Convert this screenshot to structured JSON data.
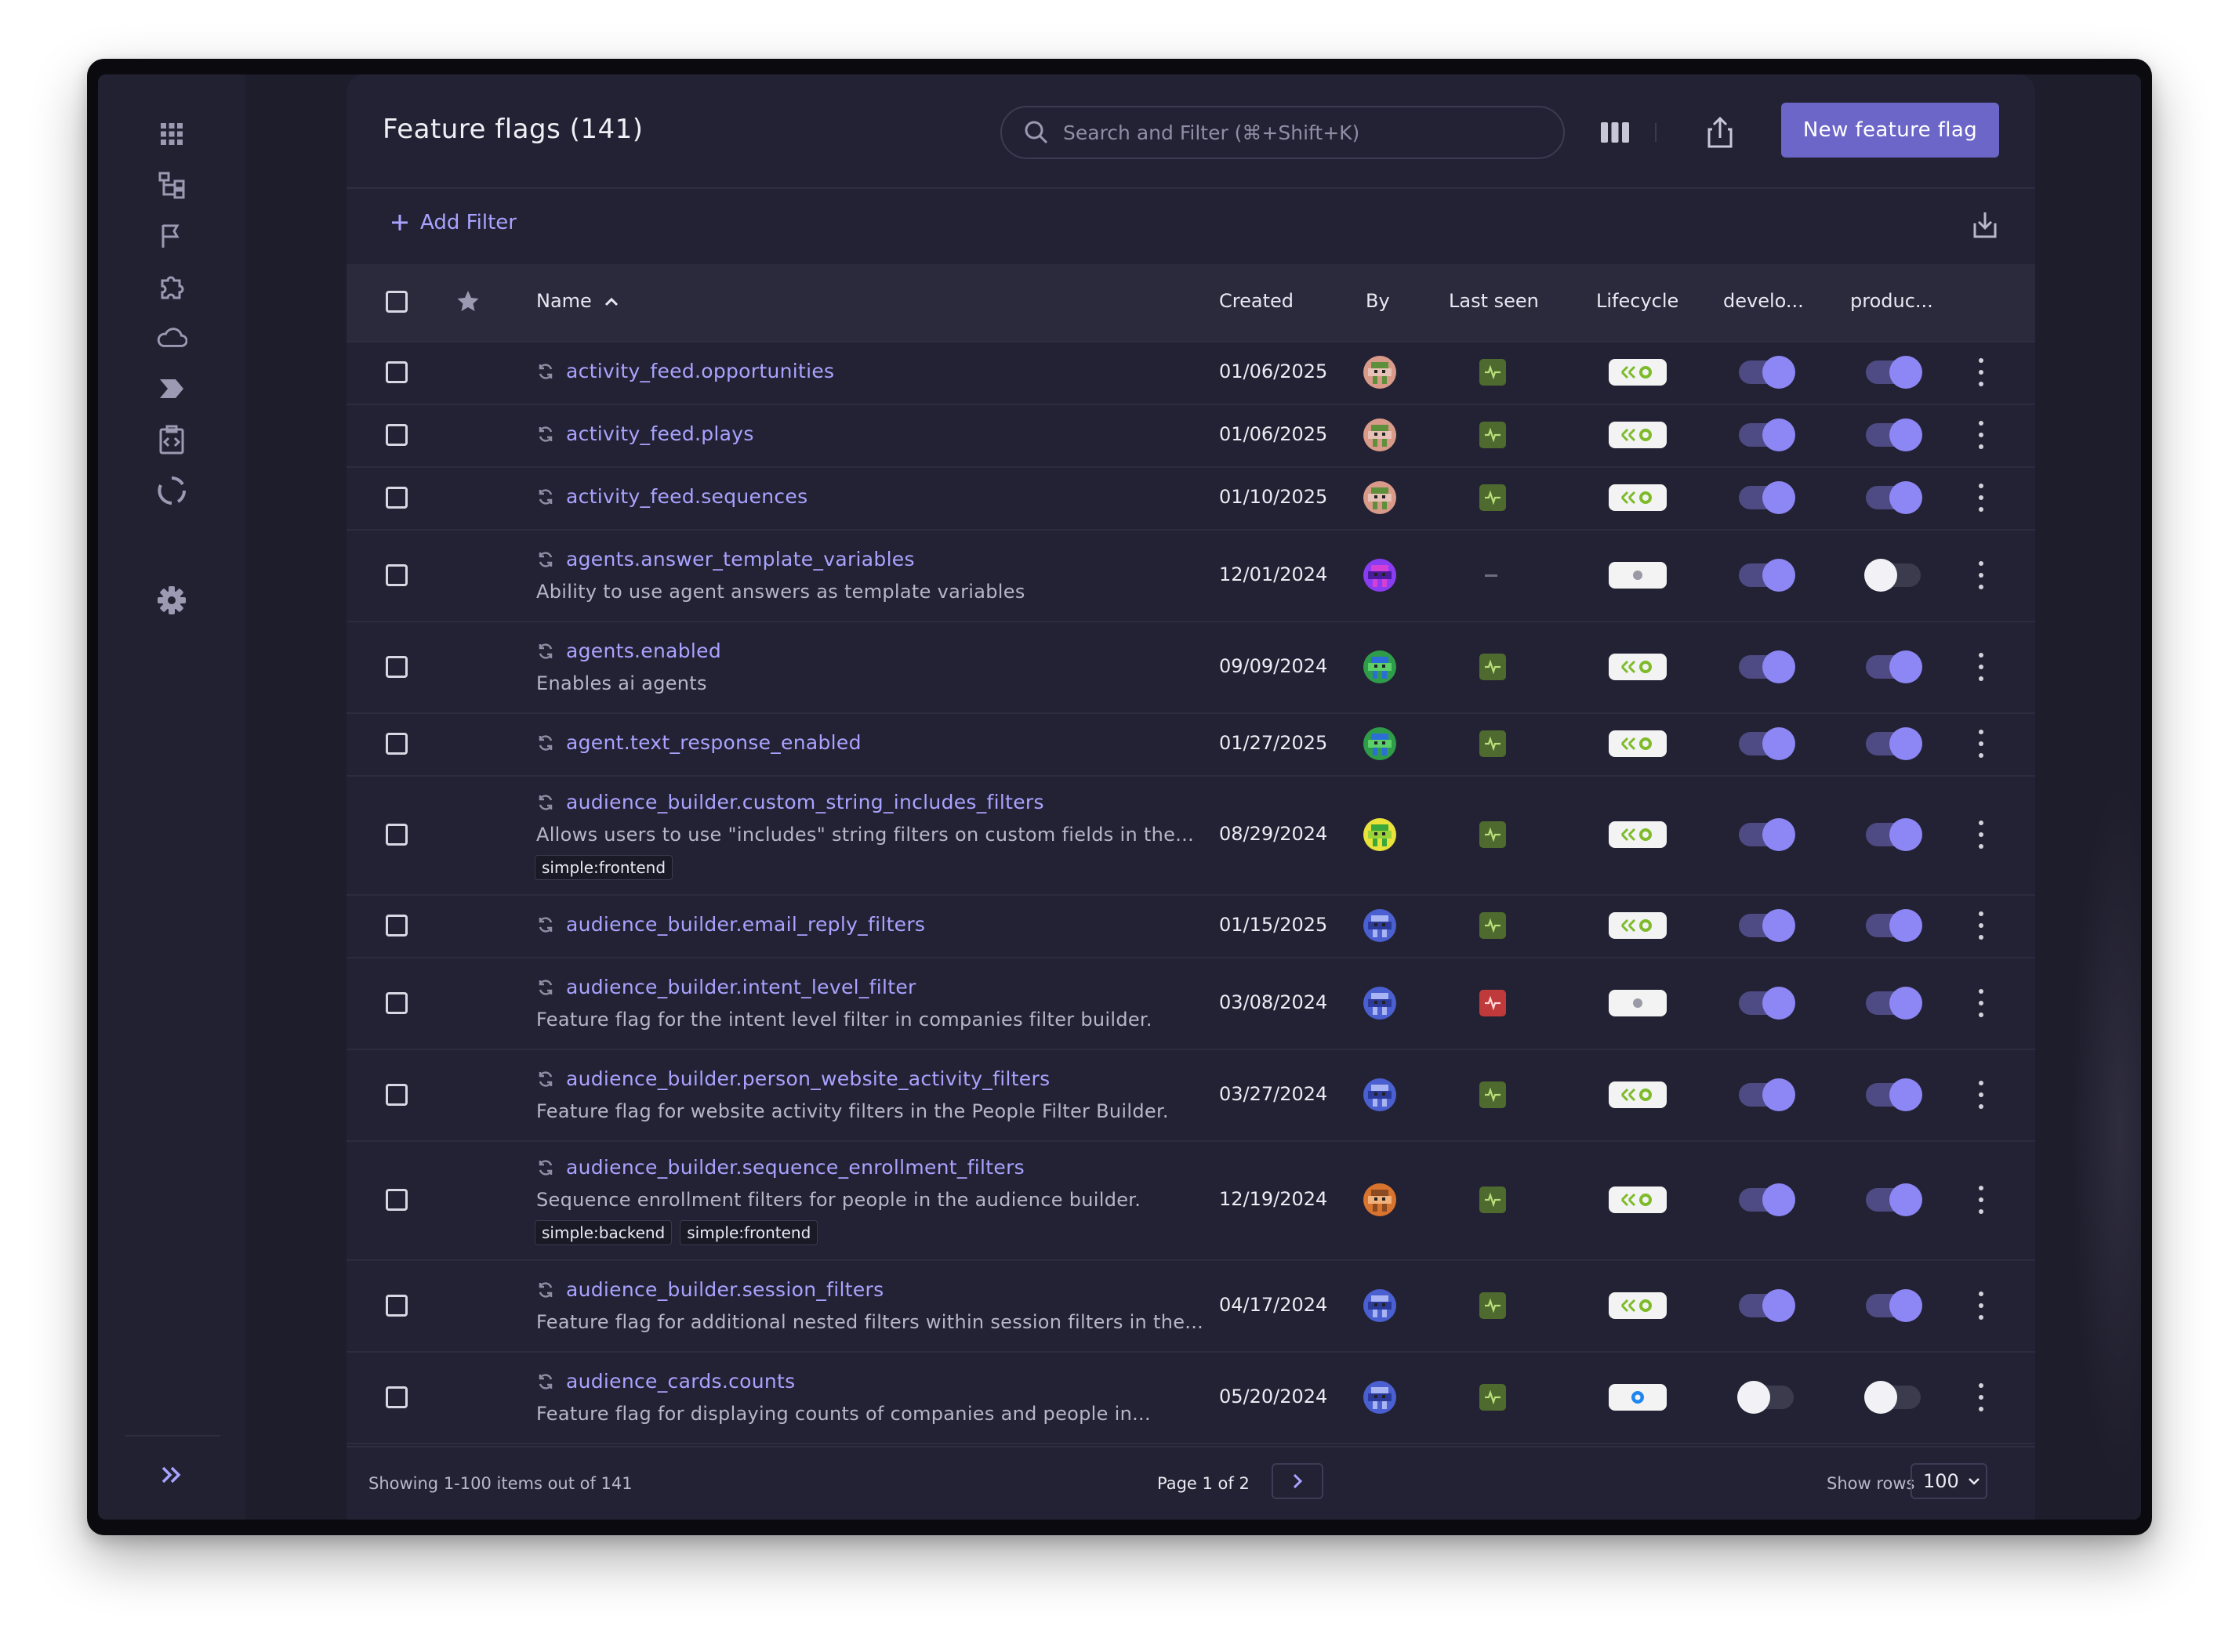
{
  "page": {
    "title": "Feature flags (141)"
  },
  "search": {
    "placeholder": "Search and Filter (⌘+Shift+K)"
  },
  "toolbar": {
    "new_flag_label": "New feature flag",
    "add_filter_label": "Add Filter"
  },
  "sidebar": {
    "icons": [
      "apps-grid-icon",
      "hierarchy-icon",
      "flag-icon",
      "puzzle-icon",
      "cloud-icon",
      "tag-arrow-icon",
      "clipboard-code-icon",
      "circle-progress-icon",
      "settings-icon"
    ],
    "expand_icon": "double-chevron-right-icon"
  },
  "table": {
    "headers": {
      "name": "Name",
      "created": "Created",
      "by": "By",
      "last_seen": "Last seen",
      "lifecycle": "Lifecycle",
      "env1": "develo...",
      "env2": "produc..."
    },
    "sort": {
      "column": "Name",
      "direction": "ascending"
    },
    "rows": [
      {
        "name": "activity_feed.opportunities",
        "description": "",
        "tags": [],
        "created": "01/06/2025",
        "avatar": "pink-green",
        "last_seen": "green",
        "lifecycle": "active",
        "dev": true,
        "prod": true
      },
      {
        "name": "activity_feed.plays",
        "description": "",
        "tags": [],
        "created": "01/06/2025",
        "avatar": "pink-green",
        "last_seen": "green",
        "lifecycle": "active",
        "dev": true,
        "prod": true
      },
      {
        "name": "activity_feed.sequences",
        "description": "",
        "tags": [],
        "created": "01/10/2025",
        "avatar": "pink-green",
        "last_seen": "green",
        "lifecycle": "active",
        "dev": true,
        "prod": true
      },
      {
        "name": "agents.answer_template_variables",
        "description": "Ability to use agent answers as template variables",
        "tags": [],
        "created": "12/01/2024",
        "avatar": "purple-magenta",
        "last_seen": "none",
        "lifecycle": "new",
        "dev": true,
        "prod": false
      },
      {
        "name": "agents.enabled",
        "description": "Enables ai agents",
        "tags": [],
        "created": "09/09/2024",
        "avatar": "green-blue",
        "last_seen": "green",
        "lifecycle": "active",
        "dev": true,
        "prod": true
      },
      {
        "name": "agent.text_response_enabled",
        "description": "",
        "tags": [],
        "created": "01/27/2025",
        "avatar": "green-blue",
        "last_seen": "green",
        "lifecycle": "active",
        "dev": true,
        "prod": true
      },
      {
        "name": "audience_builder.custom_string_includes_filters",
        "description": "Allows users to use \"includes\" string filters on custom fields in the...",
        "tags": [
          "simple:frontend"
        ],
        "created": "08/29/2024",
        "avatar": "yellow-green",
        "last_seen": "green",
        "lifecycle": "active",
        "dev": true,
        "prod": true
      },
      {
        "name": "audience_builder.email_reply_filters",
        "description": "",
        "tags": [],
        "created": "01/15/2025",
        "avatar": "blue-lavender",
        "last_seen": "green",
        "lifecycle": "active",
        "dev": true,
        "prod": true
      },
      {
        "name": "audience_builder.intent_level_filter",
        "description": "Feature flag for the intent level filter in companies filter builder.",
        "tags": [],
        "created": "03/08/2024",
        "avatar": "blue-lavender",
        "last_seen": "red",
        "lifecycle": "new",
        "dev": true,
        "prod": true
      },
      {
        "name": "audience_builder.person_website_activity_filters",
        "description": "Feature flag for website activity filters in the People Filter Builder.",
        "tags": [],
        "created": "03/27/2024",
        "avatar": "blue-lavender",
        "last_seen": "green",
        "lifecycle": "active",
        "dev": true,
        "prod": true
      },
      {
        "name": "audience_builder.sequence_enrollment_filters",
        "description": "Sequence enrollment filters for people in the audience builder.",
        "tags": [
          "simple:backend",
          "simple:frontend"
        ],
        "created": "12/19/2024",
        "avatar": "orange-brown",
        "last_seen": "green",
        "lifecycle": "active",
        "dev": true,
        "prod": true
      },
      {
        "name": "audience_builder.session_filters",
        "description": "Feature flag for additional nested filters within session filters in the...",
        "tags": [],
        "created": "04/17/2024",
        "avatar": "blue-lavender",
        "last_seen": "green",
        "lifecycle": "active",
        "dev": true,
        "prod": true
      },
      {
        "name": "audience_cards.counts",
        "description": "Feature flag for displaying counts of companies and people in...",
        "tags": [],
        "created": "05/20/2024",
        "avatar": "blue-lavender",
        "last_seen": "green",
        "lifecycle": "blue",
        "dev": false,
        "prod": false
      }
    ]
  },
  "footer": {
    "showing": "Showing 1-100 items out of 141",
    "page": "Page 1 of 2",
    "show_rows_label": "Show rows",
    "rows_per_page": "100"
  },
  "colors": {
    "accent": "#6b66c8",
    "link": "#a9a3ff",
    "toggle_on": "#8d86f5",
    "seen_green": "#4f6a2f",
    "seen_red": "#c0393b",
    "lifecycle_green": "#7dbb2a"
  }
}
